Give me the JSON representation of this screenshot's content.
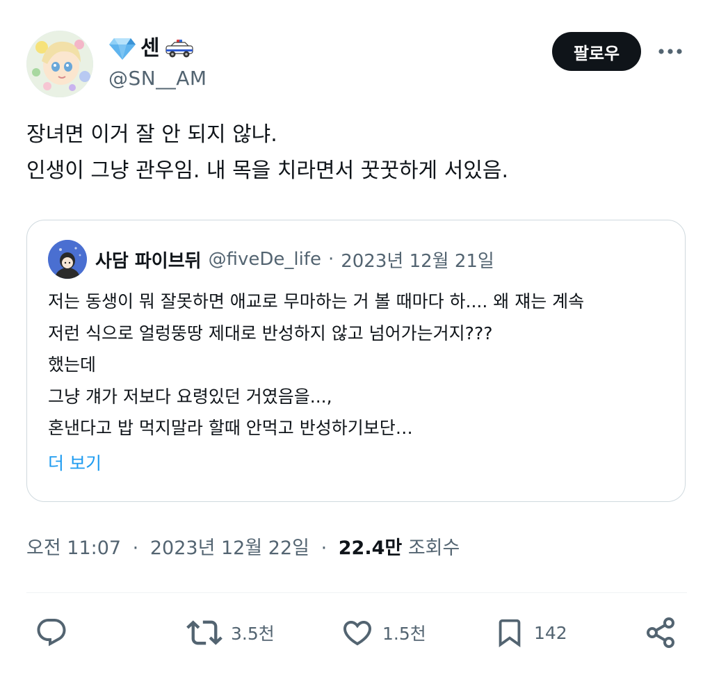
{
  "author": {
    "display_name": "센",
    "handle": "@SN__AM",
    "name_emoji_left": "gem-icon",
    "name_emoji_right": "police-car-icon"
  },
  "follow_label": "팔로우",
  "tweet": {
    "lines": [
      "장녀면 이거 잘 안 되지 않냐.",
      "인생이 그냥 관우임. 내 목을 치라면서 꿋꿋하게 서있음."
    ]
  },
  "quote": {
    "name": "사담 파이브뒤",
    "handle": "@fiveDe_life",
    "separator": "·",
    "date": "2023년 12월 21일",
    "lines": [
      "저는 동생이 뭐 잘못하면 애교로 무마하는 거 볼 때마다 하.... 왜 쟤는 계속",
      "저런 식으로 얼렁뚱땅 제대로 반성하지 않고 넘어가는거지???",
      "했는데",
      "그냥 걔가 저보다 요령있던 거였음을...,",
      "혼낸다고 밥 먹지말라 할때 안먹고 반성하기보단…"
    ],
    "show_more": "더 보기"
  },
  "meta": {
    "time": "오전 11:07",
    "separator": "·",
    "date": "2023년 12월 22일",
    "views_count": "22.4만",
    "views_label": "조회수"
  },
  "actions": {
    "retweets": "3.5천",
    "likes": "1.5천",
    "bookmarks": "142"
  },
  "colors": {
    "text": "#0f1419",
    "secondary": "#536471",
    "link": "#1d9bf0",
    "border": "#cfd9de",
    "follow_bg": "#0f1419"
  }
}
